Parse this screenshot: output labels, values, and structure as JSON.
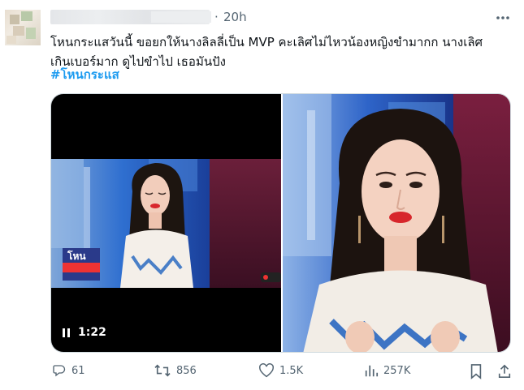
{
  "header": {
    "separator": "·",
    "time": "20h"
  },
  "tweet": {
    "text_line1": "โหนกระแสวันนี้ ขอยกให้นางลิลลี่เป็น MVP คะเลิศไม่ไหวน้องหญิงขำมากก นางเลิศ",
    "text_line2": "เกินเบอร์มาก ดูไปขำไป เธอมันปัง",
    "hashtag": "#โหนกระแส"
  },
  "media": {
    "video_time": "1:22"
  },
  "actions": {
    "replies": "61",
    "reposts": "856",
    "likes": "1.5K",
    "views": "257K"
  },
  "colors": {
    "link": "#1d9bf0",
    "secondary_text": "#536471",
    "primary_text": "#0f1419",
    "border": "#cfd9de"
  },
  "icons": {
    "more": "more-horizontal-icon",
    "reply": "reply-icon",
    "repost": "repost-icon",
    "like": "heart-icon",
    "views": "views-chart-icon",
    "bookmark": "bookmark-icon",
    "share": "share-icon",
    "pause": "pause-icon"
  }
}
